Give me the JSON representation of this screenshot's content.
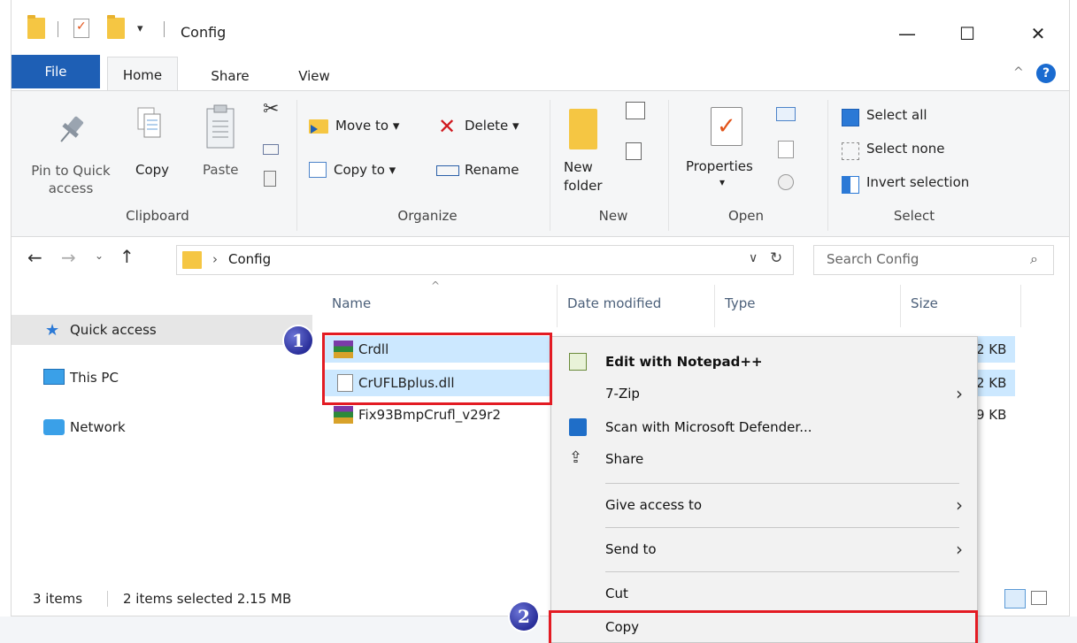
{
  "window": {
    "title": "Config",
    "controls": {
      "minimize": "—",
      "maximize": "☐",
      "close": "✕"
    }
  },
  "ribbon": {
    "tabs": [
      "File",
      "Home",
      "Share",
      "View"
    ],
    "help": "?",
    "clipboard": {
      "pin": "Pin to Quick",
      "pin2": "access",
      "copy": "Copy",
      "paste": "Paste",
      "label": "Clipboard"
    },
    "organize": {
      "move_to": "Move to ▾",
      "copy_to": "Copy to ▾",
      "delete": "Delete ▾",
      "rename": "Rename",
      "label": "Organize"
    },
    "new": {
      "new_folder": "New",
      "new_folder2": "folder",
      "label": "New"
    },
    "open": {
      "properties": "Properties",
      "properties_arrow": "▾",
      "label": "Open"
    },
    "select": {
      "select_all": "Select all",
      "select_none": "Select none",
      "invert": "Invert selection",
      "label": "Select"
    }
  },
  "address": {
    "crumb": "Config",
    "crumb_sep": "›",
    "search_placeholder": "Search Config"
  },
  "nav": {
    "items": [
      "Quick access",
      "This PC",
      "Network"
    ]
  },
  "list": {
    "columns": [
      "Name",
      "Date modified",
      "Type",
      "Size"
    ],
    "files": [
      {
        "name": "Crdll",
        "size": "2 KB",
        "selected": true
      },
      {
        "name": "CrUFLBplus.dll",
        "size": "2 KB",
        "selected": true
      },
      {
        "name": "Fix93BmpCrufl_v29r2",
        "size": "9 KB",
        "selected": false
      }
    ]
  },
  "status": {
    "count": "3 items",
    "selection": "2 items selected  2.15 MB"
  },
  "context_menu": {
    "items": [
      "Edit with Notepad++",
      "7-Zip",
      "Scan with Microsoft Defender...",
      "Share",
      "Give access to",
      "Send to",
      "Cut",
      "Copy"
    ]
  },
  "annotations": {
    "step1": "1",
    "step2": "2"
  },
  "colors": {
    "file_tab": "#1e5fb5",
    "selection": "#cce8ff",
    "highlight": "#e31b23",
    "badge": "#2a2f9a"
  }
}
